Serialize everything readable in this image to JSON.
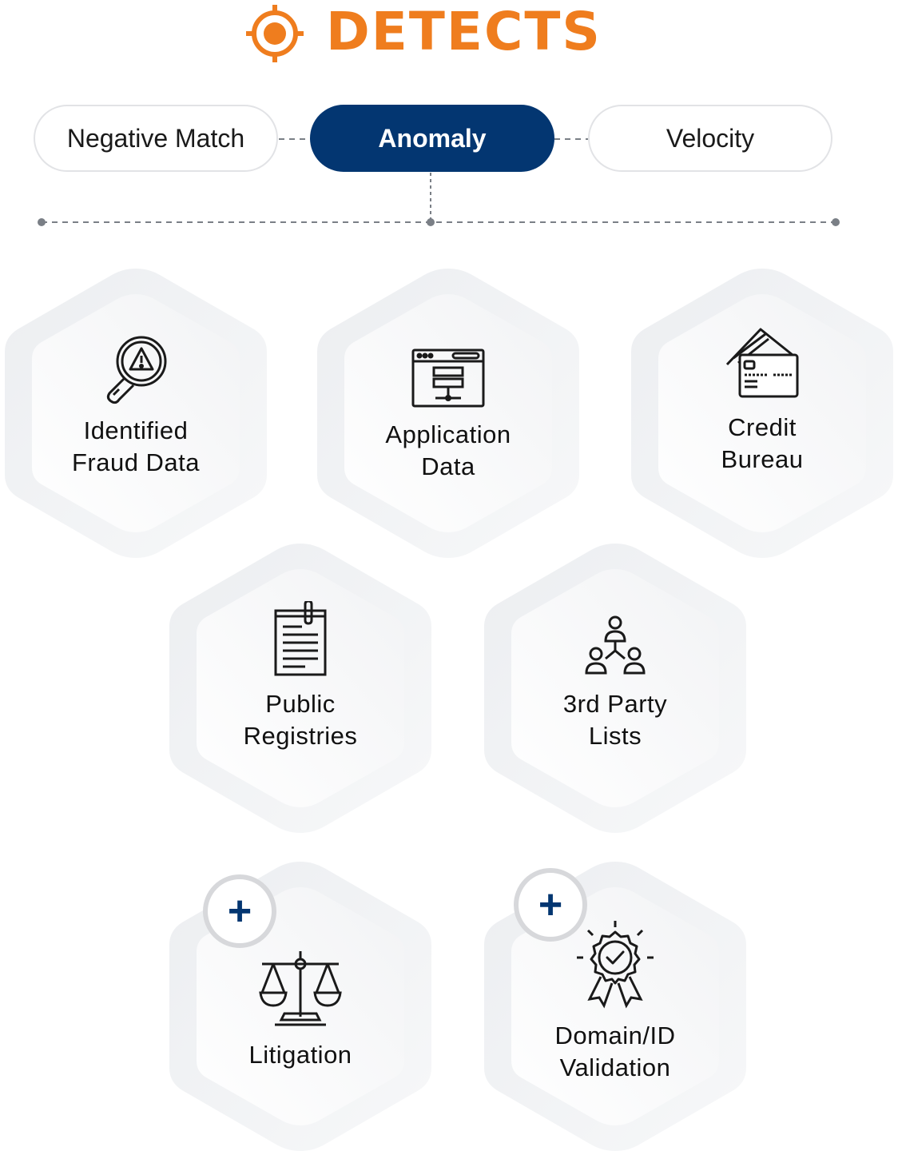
{
  "header": {
    "title": "DETECTS",
    "icon": "crosshair-icon",
    "accent": "#ef7d1e"
  },
  "tabs": [
    {
      "label": "Negative Match",
      "active": false
    },
    {
      "label": "Anomaly",
      "active": true
    },
    {
      "label": "Velocity",
      "active": false
    }
  ],
  "colors": {
    "active_tab": "#033671",
    "plus": "#033671",
    "hex_fill": "#f0f1f3"
  },
  "sources": [
    {
      "label_line1": "Identified",
      "label_line2": "Fraud Data",
      "icon": "magnifier-alert-icon"
    },
    {
      "label_line1": "Application",
      "label_line2": "Data",
      "icon": "browser-server-icon"
    },
    {
      "label_line1": "Credit",
      "label_line2": "Bureau",
      "icon": "credit-cards-icon"
    },
    {
      "label_line1": "Public",
      "label_line2": "Registries",
      "icon": "clipboard-document-icon"
    },
    {
      "label_line1": "3rd Party",
      "label_line2": "Lists",
      "icon": "people-network-icon"
    },
    {
      "label_line1": "Litigation",
      "label_line2": "",
      "icon": "scales-icon",
      "addon": true
    },
    {
      "label_line1": "Domain/ID",
      "label_line2": "Validation",
      "icon": "award-badge-icon",
      "addon": true
    }
  ],
  "addon_symbol": "+"
}
